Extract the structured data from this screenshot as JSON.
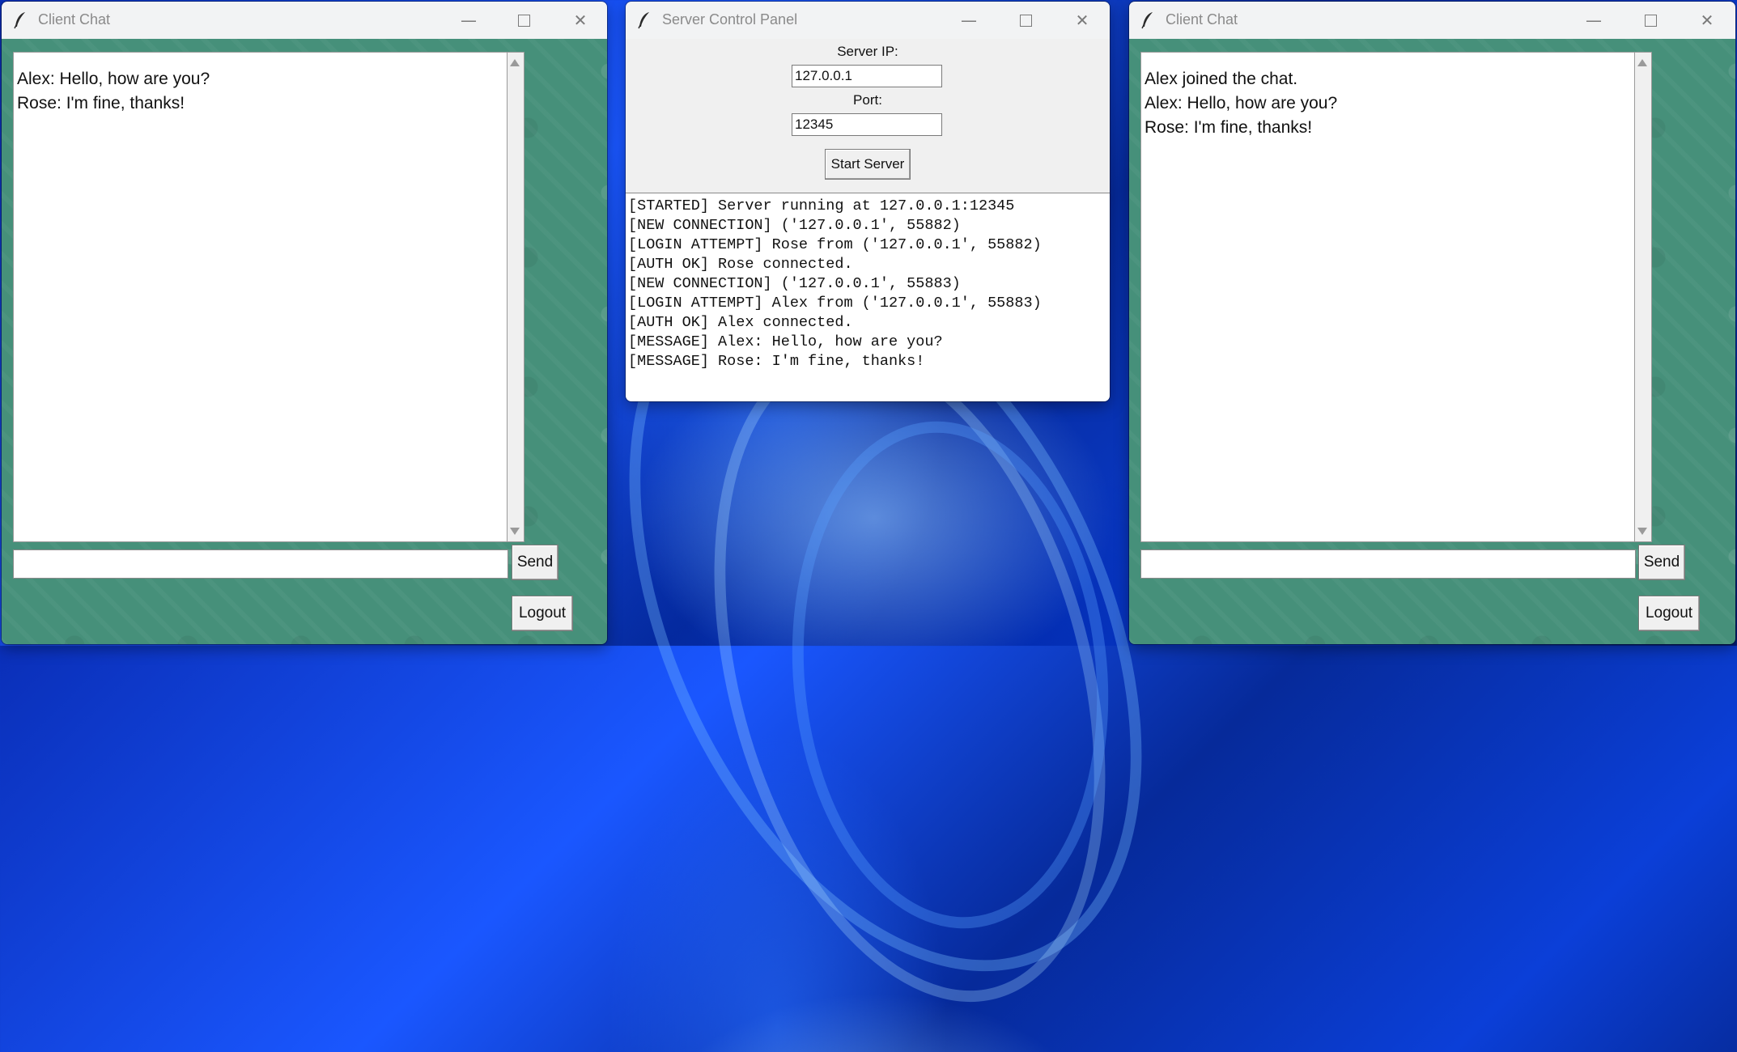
{
  "windows": {
    "client_left": {
      "title": "Client Chat",
      "messages": [
        "Alex: Hello, how are you?",
        "Rose: I'm fine, thanks!"
      ],
      "input_value": "",
      "send_label": "Send",
      "logout_label": "Logout"
    },
    "server": {
      "title": "Server Control Panel",
      "server_ip_label": "Server IP:",
      "server_ip_value": "127.0.0.1",
      "port_label": "Port:",
      "port_value": "12345",
      "start_label": "Start Server",
      "log": [
        "[STARTED] Server running at 127.0.0.1:12345",
        "[NEW CONNECTION] ('127.0.0.1', 55882)",
        "[LOGIN ATTEMPT] Rose from ('127.0.0.1', 55882)",
        "[AUTH OK] Rose connected.",
        "[NEW CONNECTION] ('127.0.0.1', 55883)",
        "[LOGIN ATTEMPT] Alex from ('127.0.0.1', 55883)",
        "[AUTH OK] Alex connected.",
        "[MESSAGE] Alex: Hello, how are you?",
        "[MESSAGE] Rose: I'm fine, thanks!"
      ]
    },
    "client_right": {
      "title": "Client Chat",
      "messages": [
        "Alex joined the chat.",
        "Alex: Hello, how are you?",
        "Rose: I'm fine, thanks!"
      ],
      "input_value": "",
      "send_label": "Send",
      "logout_label": "Logout"
    }
  },
  "icons": {
    "app": "feather-icon",
    "minimize": "minimize-icon",
    "maximize": "maximize-icon",
    "close": "close-icon"
  },
  "colors": {
    "chat_background": "#46907a",
    "titlebar": "#f2f3f4",
    "desktop_accent": "#1a57ff"
  }
}
